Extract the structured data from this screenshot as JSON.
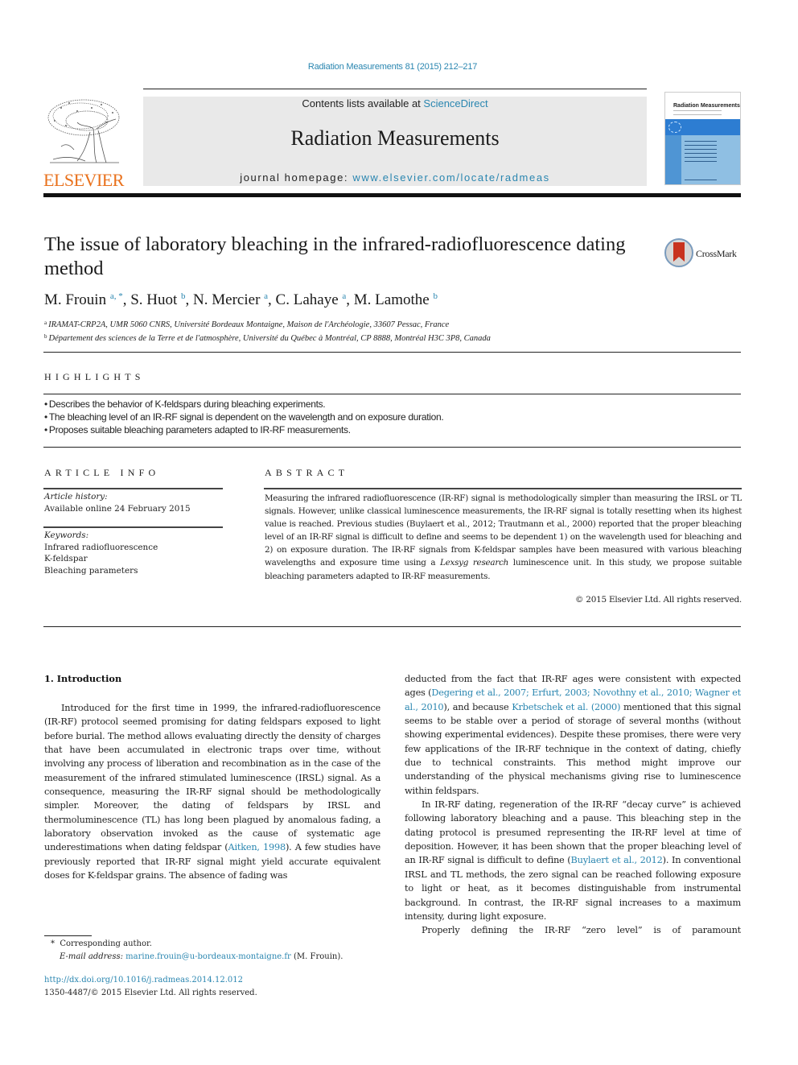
{
  "header": {
    "citation": "Radiation Measurements 81 (2015) 212–217",
    "publisher_wordmark": "ELSEVIER",
    "contents_prefix": "Contents lists available at ",
    "contents_link": "ScienceDirect",
    "journal_title": "Radiation Measurements",
    "homepage_prefix": "journal homepage: ",
    "homepage_link": "www.elsevier.com/locate/radmeas",
    "cover_title": "Radiation Measurements",
    "crossmark_label": "CrossMark",
    "colors": {
      "link": "#2a86b0",
      "elsevier_orange": "#e9711c",
      "cover_blue": "#2d7dd2"
    }
  },
  "article": {
    "title": "The issue of laboratory bleaching in the infrared-radiofluorescence dating method",
    "authors": [
      {
        "name": "M. Frouin",
        "sup": "a, *"
      },
      {
        "name": "S. Huot",
        "sup": "b"
      },
      {
        "name": "N. Mercier",
        "sup": "a"
      },
      {
        "name": "C. Lahaye",
        "sup": "a"
      },
      {
        "name": "M. Lamothe",
        "sup": "b"
      }
    ],
    "affiliations": [
      {
        "key": "a",
        "text": "IRAMAT-CRP2A, UMR 5060 CNRS, Université Bordeaux Montaigne, Maison de l'Archéologie, 33607 Pessac, France"
      },
      {
        "key": "b",
        "text": "Département des sciences de la Terre et de l'atmosphère, Université du Québec à Montréal, CP 8888, Montréal H3C 3P8, Canada"
      }
    ]
  },
  "highlights": {
    "label": "HIGHLIGHTS",
    "items": [
      "Describes the behavior of K-feldspars during bleaching experiments.",
      "The bleaching level of an IR-RF signal is dependent on the wavelength and on exposure duration.",
      "Proposes suitable bleaching parameters adapted to IR-RF measurements."
    ]
  },
  "article_info": {
    "label": "ARTICLE INFO",
    "history_label": "Article history:",
    "history_value": "Available online 24 February 2015",
    "keywords_label": "Keywords:",
    "keywords": [
      "Infrared radiofluorescence",
      "K-feldspar",
      "Bleaching parameters"
    ]
  },
  "abstract": {
    "label": "ABSTRACT",
    "text_1": "Measuring the infrared radiofluorescence (IR-RF) signal is methodologically simpler than measuring the IRSL or TL signals. However, unlike classical luminescence measurements, the IR-RF signal is totally resetting when its highest value is reached. Previous studies (Buylaert et al., 2012; Trautmann et al., 2000) reported that the proper bleaching level of an IR-RF signal is difficult to define and seems to be dependent 1) on the wavelength used for bleaching and 2) on exposure duration. The IR-RF signals from K-feldspar samples have been measured with various bleaching wavelengths and exposure time using a ",
    "text_italic": "Lexsyg research",
    "text_2": " luminescence unit. In this study, we propose suitable bleaching parameters adapted to IR-RF measurements.",
    "copyright": "© 2015 Elsevier Ltd. All rights reserved."
  },
  "body": {
    "section_heading": "1.  Introduction",
    "left_p1_a": "Introduced for the first time in 1999, the infrared-radiofluorescence (IR-RF) protocol seemed promising for dating feldspars exposed to light before burial. The method allows evaluating directly the density of charges that have been accumulated in electronic traps over time, without involving any process of liberation and recombination as in the case of the measurement of the infrared stimulated luminescence (IRSL) signal. As a consequence, measuring the IR-RF signal should be methodologically simpler. Moreover, the dating of feldspars by IRSL and thermoluminescence (TL) has long been plagued by anomalous fading, a laboratory observation invoked as the cause of systematic age underestimations when dating feldspar (",
    "left_p1_ref": "Aitken, 1998",
    "left_p1_b": "). A few studies have previously reported that IR-RF signal might yield accurate equivalent doses for K-feldspar grains. The absence of fading was",
    "right_p1_a": "deducted from the fact that IR-RF ages were consistent with expected ages (",
    "right_p1_ref1": "Degering et al., 2007; Erfurt, 2003; Novothny et al., 2010; Wagner et al., 2010",
    "right_p1_b": "), and because ",
    "right_p1_ref2": "Krbetschek et al. (2000)",
    "right_p1_c": " mentioned that this signal seems to be stable over a period of storage of several months (without showing experimental evidences). Despite these promises, there were very few applications of the IR-RF technique in the context of dating, chiefly due to technical constraints. This method might improve our understanding of the physical mechanisms giving rise to luminescence within feldspars.",
    "right_p2_a": "In IR-RF dating, regeneration of the IR-RF “decay curve” is achieved following laboratory bleaching and a pause. This bleaching step in the dating protocol is presumed representing the IR-RF level at time of deposition. However, it has been shown that the proper bleaching level of an IR-RF signal is difficult to define (",
    "right_p2_ref": "Buylaert et al., 2012",
    "right_p2_b": "). In conventional IRSL and TL methods, the zero signal can be reached following exposure to light or heat, as it becomes distinguishable from instrumental background. In contrast, the IR-RF signal increases to a maximum intensity, during light exposure.",
    "right_p3": "Properly defining the IR-RF “zero level” is of paramount"
  },
  "footnote": {
    "mark": "*",
    "corresponding": "Corresponding author.",
    "email_label": "E-mail address:",
    "email": "marine.frouin@u-bordeaux-montaigne.fr",
    "email_suffix": " (M. Frouin).",
    "doi": "http://dx.doi.org/10.1016/j.radmeas.2014.12.012",
    "issn_copyright": "1350-4487/© 2015 Elsevier Ltd. All rights reserved."
  }
}
